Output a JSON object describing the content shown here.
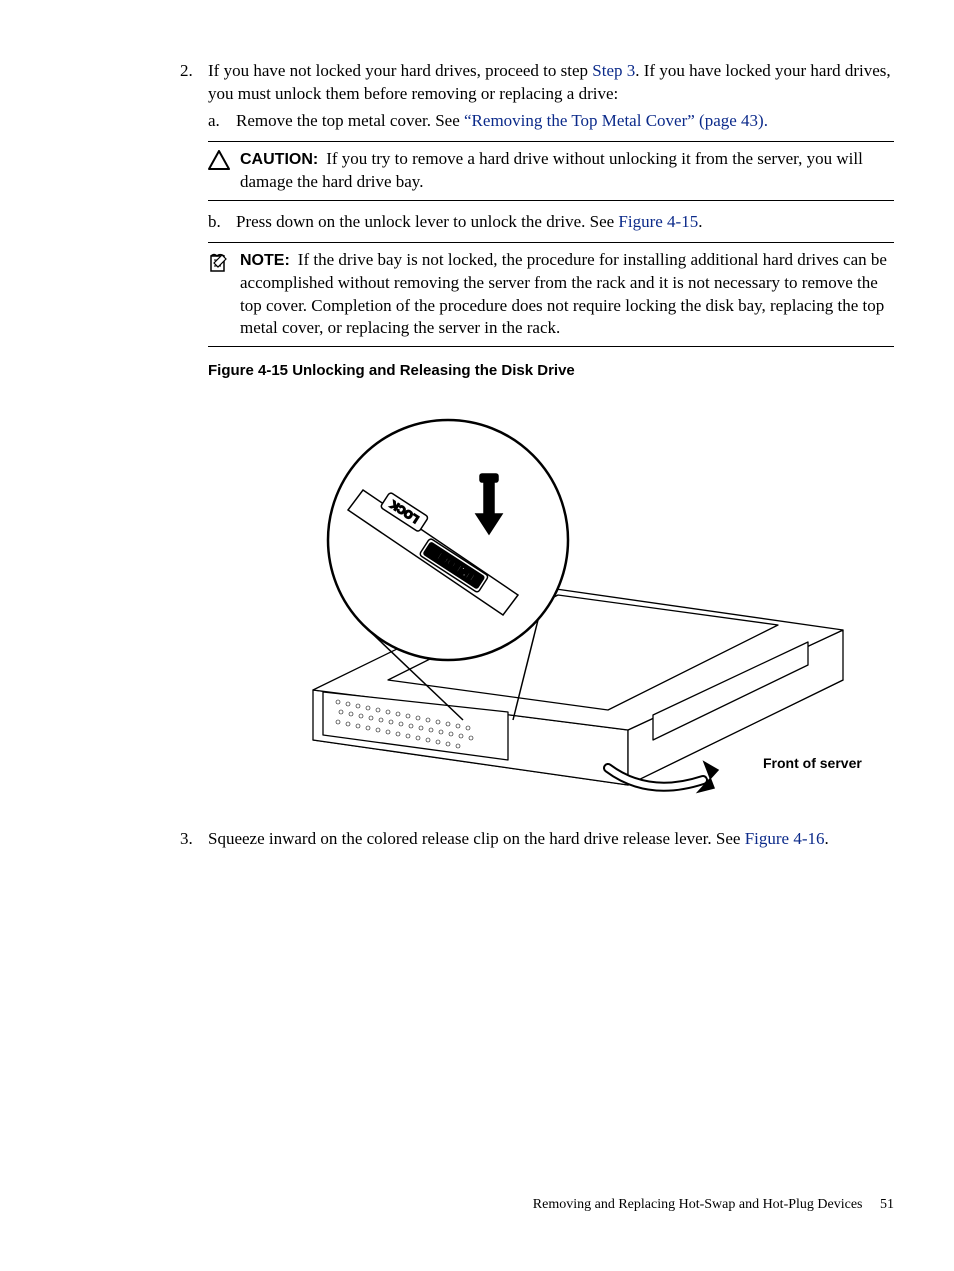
{
  "step2": {
    "num": "2.",
    "text_a": "If you have not locked your hard drives, proceed to step ",
    "link_step3": "Step 3",
    "text_b": ". If you have locked your hard drives, you must unlock them before removing or replacing a drive:",
    "sub_a": {
      "letter": "a.",
      "text_a": "Remove the top metal cover. See ",
      "link": "“Removing the Top Metal Cover” (page 43).",
      "text_b": ""
    },
    "sub_b": {
      "letter": "b.",
      "text_a": "Press down on the unlock lever to unlock the drive. See ",
      "link": "Figure 4-15",
      "text_b": "."
    }
  },
  "caution": {
    "label": "CAUTION:",
    "text": "If you try to remove a hard drive without unlocking it from the server, you will damage the hard drive bay."
  },
  "note": {
    "label": "NOTE:",
    "text": "If the drive bay is not locked, the procedure for installing additional hard drives can be accomplished without removing the server from the rack and it is not necessary to remove the top cover. Completion of the procedure does not require locking the disk bay, replacing the top metal cover, or replacing the server in the rack."
  },
  "figure_caption": "Figure 4-15  Unlocking and Releasing the Disk Drive",
  "figure_label_front": "Front of server",
  "step3": {
    "num": "3.",
    "text_a": "Squeeze inward on the colored release clip on the hard drive release lever. See ",
    "link": "Figure 4-16",
    "text_b": "."
  },
  "footer": {
    "section": "Removing and Replacing Hot-Swap and Hot-Plug Devices",
    "page": "51"
  },
  "icons": {
    "caution": "warning-triangle-icon",
    "note": "note-pencil-icon"
  }
}
